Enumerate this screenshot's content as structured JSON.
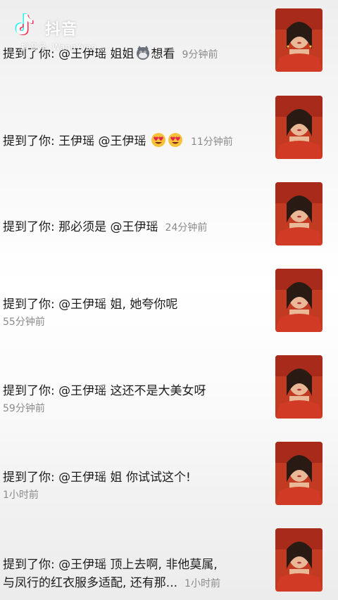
{
  "watermark": {
    "app_name": "抖音",
    "account_id": "抖音号: WangYyao"
  },
  "colors": {
    "text": "#1c1c1c",
    "time": "#8a8a8a",
    "thumb_bg": "#c23a22"
  },
  "mentions": [
    {
      "prefix": "提到了你: ",
      "text": "@王伊瑶 姐姐",
      "emoji": [
        "cat-face-icon"
      ],
      "suffix": "想看",
      "time": "9分钟前",
      "time_inline": true
    },
    {
      "prefix": "提到了你: ",
      "text": "王伊瑶 @王伊瑶 ",
      "emoji": [
        "heart-eyes-icon",
        "heart-eyes-icon"
      ],
      "suffix": "",
      "time": "11分钟前",
      "time_inline": true
    },
    {
      "prefix": "提到了你: ",
      "text": "那必须是 @王伊瑶",
      "emoji": [],
      "suffix": "",
      "time": "24分钟前",
      "time_inline": true
    },
    {
      "prefix": "提到了你: ",
      "text": "@王伊瑶 姐, 她夸你呢",
      "emoji": [],
      "suffix": "",
      "time": "55分钟前",
      "time_inline": false
    },
    {
      "prefix": "提到了你: ",
      "text": "@王伊瑶 这还不是大美女呀",
      "emoji": [],
      "suffix": "",
      "time": "59分钟前",
      "time_inline": false
    },
    {
      "prefix": "提到了你: ",
      "text": "@王伊瑶 姐 你试试这个!",
      "emoji": [],
      "suffix": "",
      "time": "1小时前",
      "time_inline": false
    },
    {
      "prefix": "提到了你: ",
      "text": "@王伊瑶 顶上去啊, 非他莫属,",
      "line2": "与凤行的红衣服多适配, 还有那...",
      "emoji": [],
      "suffix": "",
      "time": "1小时前",
      "time_inline": true
    }
  ]
}
